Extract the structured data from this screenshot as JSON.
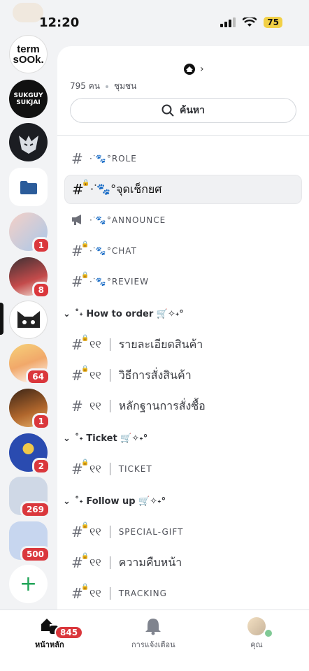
{
  "status": {
    "time": "12:20",
    "battery": "75"
  },
  "servers": [
    {
      "id": "termsook",
      "label": "term sOOk.",
      "badge": ""
    },
    {
      "id": "sukguy",
      "label": "SUKGUY SUKJAI",
      "badge": ""
    },
    {
      "id": "wolf",
      "label": "",
      "badge": ""
    },
    {
      "id": "folder",
      "label": "",
      "badge": ""
    },
    {
      "id": "anime1",
      "label": "",
      "badge": "1"
    },
    {
      "id": "witch",
      "label": "",
      "badge": "8"
    },
    {
      "id": "cat",
      "label": "",
      "badge": ""
    },
    {
      "id": "kid",
      "label": "",
      "badge": "64"
    },
    {
      "id": "portrait",
      "label": "",
      "badge": "1"
    },
    {
      "id": "eyes",
      "label": "",
      "badge": "2"
    },
    {
      "id": "group1",
      "label": "",
      "badge": "269"
    },
    {
      "id": "group2",
      "label": "",
      "badge": "500"
    }
  ],
  "header": {
    "members": "795 คน",
    "community": "ชุมชน",
    "search": "ค้นหา"
  },
  "channels": [
    {
      "type": "text",
      "label": "·ᐝ🐾°ROLE",
      "locked": false,
      "selected": false
    },
    {
      "type": "text",
      "label": "·ᐝ🐾°จุดเช็กยศ",
      "locked": true,
      "selected": true
    },
    {
      "type": "announce",
      "label": "·ᐝ🐾°ANNOUNCE",
      "locked": true,
      "selected": false
    },
    {
      "type": "text",
      "label": "·ᐝ🐾°CHAT",
      "locked": true,
      "selected": false
    },
    {
      "type": "text",
      "label": "·ᐝ🐾°REVIEW",
      "locked": true,
      "selected": false
    }
  ],
  "categories": [
    {
      "label": "˚˖ How to order 🛒✧˖°",
      "channels": [
        {
          "prefix": "୧୧",
          "label": "รายละเอียดสินค้า",
          "locked": true
        },
        {
          "prefix": "୧୧",
          "label": "วิธีการสั่งสินค้า",
          "locked": true
        },
        {
          "prefix": "୧୧",
          "label": "หลักฐานการสั่งซื้อ",
          "locked": false
        }
      ]
    },
    {
      "label": "˚˖ Ticket 🛒✧˖°",
      "channels": [
        {
          "prefix": "୧୧",
          "label": "TICKET",
          "locked": true
        }
      ]
    },
    {
      "label": "˚˖ Follow up 🛒✧˖°",
      "channels": [
        {
          "prefix": "୧୧",
          "label": "SPECIAL-GIFT",
          "locked": true
        },
        {
          "prefix": "୧୧",
          "label": "ความคืบหน้า",
          "locked": true
        },
        {
          "prefix": "୧୧",
          "label": "TRACKING",
          "locked": true
        }
      ]
    }
  ],
  "nav": {
    "home": "หน้าหลัก",
    "home_badge": "845",
    "notifications": "การแจ้งเตือน",
    "you": "คุณ"
  },
  "colors": {
    "badge": "#da373c",
    "online": "#80c995",
    "accent_green": "#23a559"
  }
}
